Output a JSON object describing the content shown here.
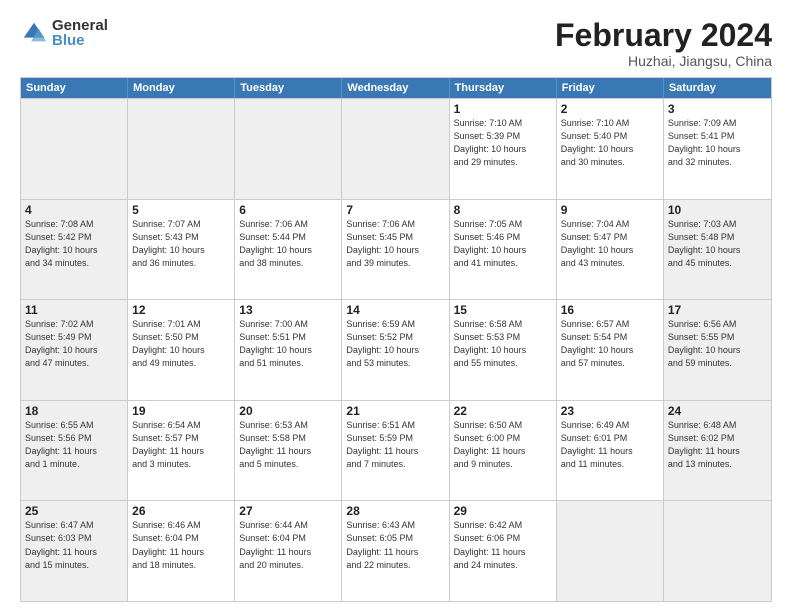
{
  "logo": {
    "general": "General",
    "blue": "Blue"
  },
  "header": {
    "month": "February 2024",
    "location": "Huzhai, Jiangsu, China"
  },
  "weekdays": [
    "Sunday",
    "Monday",
    "Tuesday",
    "Wednesday",
    "Thursday",
    "Friday",
    "Saturday"
  ],
  "weeks": [
    [
      {
        "day": "",
        "info": "",
        "shaded": true
      },
      {
        "day": "",
        "info": "",
        "shaded": true
      },
      {
        "day": "",
        "info": "",
        "shaded": true
      },
      {
        "day": "",
        "info": "",
        "shaded": true
      },
      {
        "day": "1",
        "info": "Sunrise: 7:10 AM\nSunset: 5:39 PM\nDaylight: 10 hours\nand 29 minutes.",
        "shaded": false
      },
      {
        "day": "2",
        "info": "Sunrise: 7:10 AM\nSunset: 5:40 PM\nDaylight: 10 hours\nand 30 minutes.",
        "shaded": false
      },
      {
        "day": "3",
        "info": "Sunrise: 7:09 AM\nSunset: 5:41 PM\nDaylight: 10 hours\nand 32 minutes.",
        "shaded": false
      }
    ],
    [
      {
        "day": "4",
        "info": "Sunrise: 7:08 AM\nSunset: 5:42 PM\nDaylight: 10 hours\nand 34 minutes.",
        "shaded": true
      },
      {
        "day": "5",
        "info": "Sunrise: 7:07 AM\nSunset: 5:43 PM\nDaylight: 10 hours\nand 36 minutes.",
        "shaded": false
      },
      {
        "day": "6",
        "info": "Sunrise: 7:06 AM\nSunset: 5:44 PM\nDaylight: 10 hours\nand 38 minutes.",
        "shaded": false
      },
      {
        "day": "7",
        "info": "Sunrise: 7:06 AM\nSunset: 5:45 PM\nDaylight: 10 hours\nand 39 minutes.",
        "shaded": false
      },
      {
        "day": "8",
        "info": "Sunrise: 7:05 AM\nSunset: 5:46 PM\nDaylight: 10 hours\nand 41 minutes.",
        "shaded": false
      },
      {
        "day": "9",
        "info": "Sunrise: 7:04 AM\nSunset: 5:47 PM\nDaylight: 10 hours\nand 43 minutes.",
        "shaded": false
      },
      {
        "day": "10",
        "info": "Sunrise: 7:03 AM\nSunset: 5:48 PM\nDaylight: 10 hours\nand 45 minutes.",
        "shaded": true
      }
    ],
    [
      {
        "day": "11",
        "info": "Sunrise: 7:02 AM\nSunset: 5:49 PM\nDaylight: 10 hours\nand 47 minutes.",
        "shaded": true
      },
      {
        "day": "12",
        "info": "Sunrise: 7:01 AM\nSunset: 5:50 PM\nDaylight: 10 hours\nand 49 minutes.",
        "shaded": false
      },
      {
        "day": "13",
        "info": "Sunrise: 7:00 AM\nSunset: 5:51 PM\nDaylight: 10 hours\nand 51 minutes.",
        "shaded": false
      },
      {
        "day": "14",
        "info": "Sunrise: 6:59 AM\nSunset: 5:52 PM\nDaylight: 10 hours\nand 53 minutes.",
        "shaded": false
      },
      {
        "day": "15",
        "info": "Sunrise: 6:58 AM\nSunset: 5:53 PM\nDaylight: 10 hours\nand 55 minutes.",
        "shaded": false
      },
      {
        "day": "16",
        "info": "Sunrise: 6:57 AM\nSunset: 5:54 PM\nDaylight: 10 hours\nand 57 minutes.",
        "shaded": false
      },
      {
        "day": "17",
        "info": "Sunrise: 6:56 AM\nSunset: 5:55 PM\nDaylight: 10 hours\nand 59 minutes.",
        "shaded": true
      }
    ],
    [
      {
        "day": "18",
        "info": "Sunrise: 6:55 AM\nSunset: 5:56 PM\nDaylight: 11 hours\nand 1 minute.",
        "shaded": true
      },
      {
        "day": "19",
        "info": "Sunrise: 6:54 AM\nSunset: 5:57 PM\nDaylight: 11 hours\nand 3 minutes.",
        "shaded": false
      },
      {
        "day": "20",
        "info": "Sunrise: 6:53 AM\nSunset: 5:58 PM\nDaylight: 11 hours\nand 5 minutes.",
        "shaded": false
      },
      {
        "day": "21",
        "info": "Sunrise: 6:51 AM\nSunset: 5:59 PM\nDaylight: 11 hours\nand 7 minutes.",
        "shaded": false
      },
      {
        "day": "22",
        "info": "Sunrise: 6:50 AM\nSunset: 6:00 PM\nDaylight: 11 hours\nand 9 minutes.",
        "shaded": false
      },
      {
        "day": "23",
        "info": "Sunrise: 6:49 AM\nSunset: 6:01 PM\nDaylight: 11 hours\nand 11 minutes.",
        "shaded": false
      },
      {
        "day": "24",
        "info": "Sunrise: 6:48 AM\nSunset: 6:02 PM\nDaylight: 11 hours\nand 13 minutes.",
        "shaded": true
      }
    ],
    [
      {
        "day": "25",
        "info": "Sunrise: 6:47 AM\nSunset: 6:03 PM\nDaylight: 11 hours\nand 15 minutes.",
        "shaded": true
      },
      {
        "day": "26",
        "info": "Sunrise: 6:46 AM\nSunset: 6:04 PM\nDaylight: 11 hours\nand 18 minutes.",
        "shaded": false
      },
      {
        "day": "27",
        "info": "Sunrise: 6:44 AM\nSunset: 6:04 PM\nDaylight: 11 hours\nand 20 minutes.",
        "shaded": false
      },
      {
        "day": "28",
        "info": "Sunrise: 6:43 AM\nSunset: 6:05 PM\nDaylight: 11 hours\nand 22 minutes.",
        "shaded": false
      },
      {
        "day": "29",
        "info": "Sunrise: 6:42 AM\nSunset: 6:06 PM\nDaylight: 11 hours\nand 24 minutes.",
        "shaded": false
      },
      {
        "day": "",
        "info": "",
        "shaded": true
      },
      {
        "day": "",
        "info": "",
        "shaded": true
      }
    ]
  ]
}
